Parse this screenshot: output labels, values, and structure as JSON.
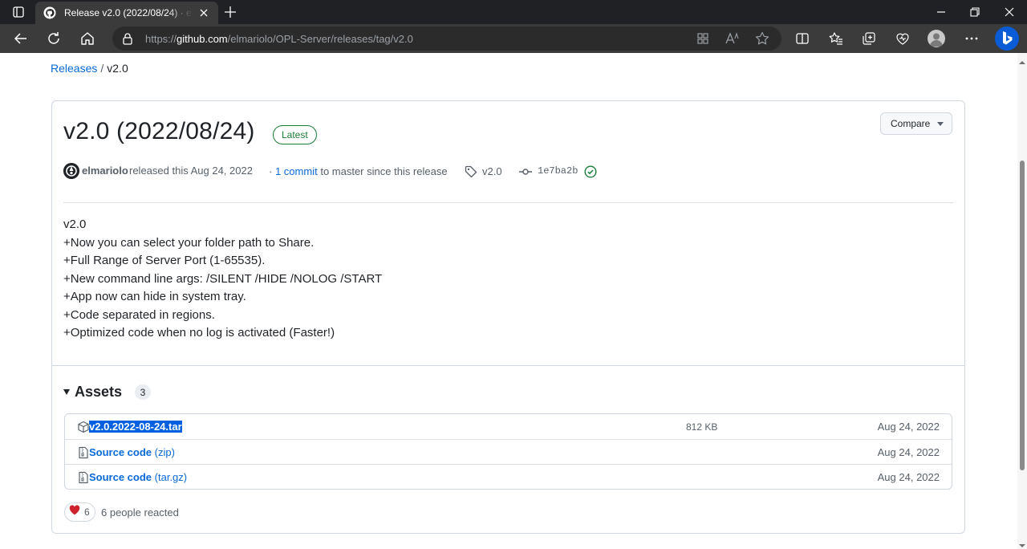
{
  "browser": {
    "tab_title": "Release v2.0 (2022/08/24) · elmariolo/OPL-Server",
    "url_prefix": "https://",
    "url_host": "github.com",
    "url_path": "/elmariolo/OPL-Server/releases/tag/v2.0"
  },
  "breadcrumb": {
    "releases_label": "Releases",
    "separator": "/",
    "current": "v2.0"
  },
  "release": {
    "title": "v2.0 (2022/08/24)",
    "latest_badge": "Latest",
    "compare_label": "Compare",
    "author": "elmariolo",
    "released_text": "released this Aug 24, 2022",
    "commits_prefix": "·",
    "commits_link": "1 commit",
    "commits_suffix": "to master since this release",
    "tag": "v2.0",
    "commit_sha": "1e7ba2b",
    "notes": [
      "v2.0",
      "+Now you can select your folder path to Share.",
      "+Full Range of Server Port (1-65535).",
      "+New command line args: /SILENT /HIDE /NOLOG /START",
      "+App now can hide in system tray.",
      "+Code separated in regions.",
      "+Optimized code when no log is activated (Faster!)"
    ]
  },
  "assets": {
    "title": "Assets",
    "count": "3",
    "items": [
      {
        "name": "v2.0.2022-08-24.tar",
        "ext": "",
        "size": "812 KB",
        "date": "Aug 24, 2022",
        "icon": "package-icon"
      },
      {
        "name": "Source code",
        "ext": "(zip)",
        "size": "",
        "date": "Aug 24, 2022",
        "icon": "file-zip-icon"
      },
      {
        "name": "Source code",
        "ext": "(tar.gz)",
        "size": "",
        "date": "Aug 24, 2022",
        "icon": "file-zip-icon"
      }
    ]
  },
  "reactions": {
    "emoji_count": "6",
    "summary": "6 people reacted"
  },
  "colors": {
    "link": "#0969da",
    "latest_green": "#1a7f37",
    "heart": "#cf222e",
    "selection": "#0060df"
  }
}
